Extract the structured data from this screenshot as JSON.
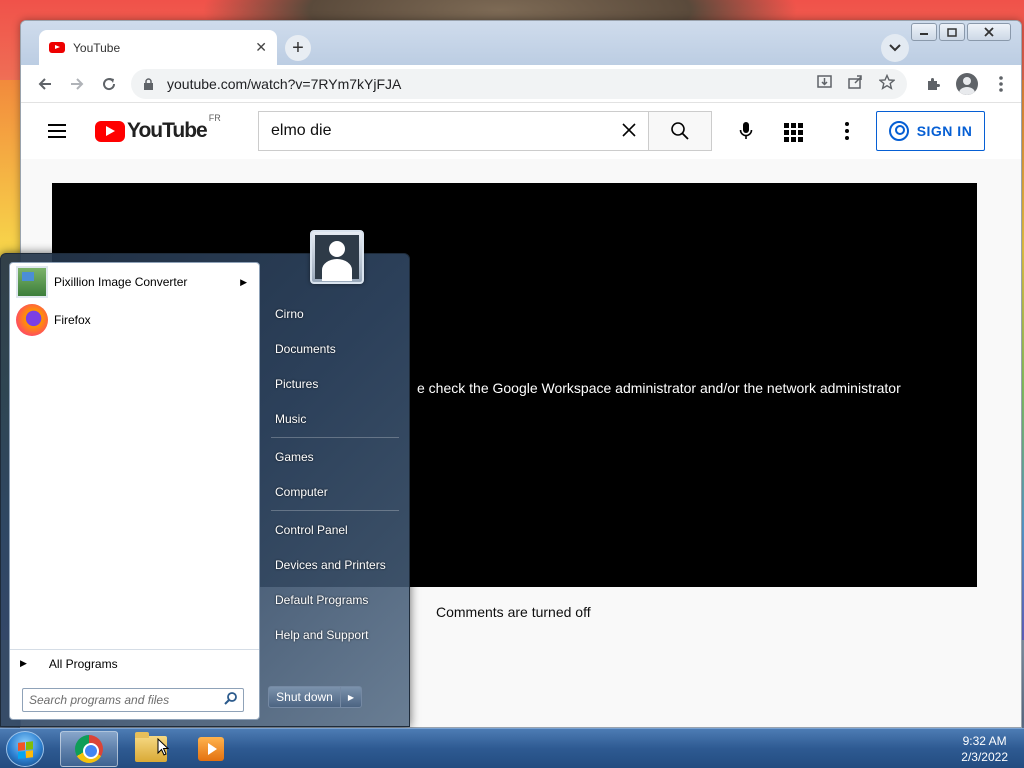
{
  "browser": {
    "tab_title": "YouTube",
    "tab_close": "✕",
    "new_tab": "+",
    "url": "youtube.com/watch?v=7RYm7kYjFJA"
  },
  "youtube": {
    "logo_text": "YouTube",
    "country_code": "FR",
    "search_value": "elmo die",
    "signin_label": "SIGN IN",
    "player_message": "e check the Google Workspace administrator and/or the network administrator",
    "comments_status": "Comments are turned off"
  },
  "start_menu": {
    "programs": [
      {
        "label": "Pixillion Image Converter",
        "icon": "pixillion-icon",
        "has_submenu": true
      },
      {
        "label": "Firefox",
        "icon": "firefox-icon",
        "has_submenu": false
      }
    ],
    "all_programs": "All Programs",
    "search_placeholder": "Search programs and files",
    "right_items": [
      "Cirno",
      "Documents",
      "Pictures",
      "Music",
      "Games",
      "Computer",
      "Control Panel",
      "Devices and Printers",
      "Default Programs",
      "Help and Support"
    ],
    "shutdown_label": "Shut down"
  },
  "taskbar": {
    "time": "9:32 AM",
    "date": "2/3/2022",
    "pinned": [
      "chrome-icon",
      "folder-icon",
      "media-player-icon"
    ]
  }
}
